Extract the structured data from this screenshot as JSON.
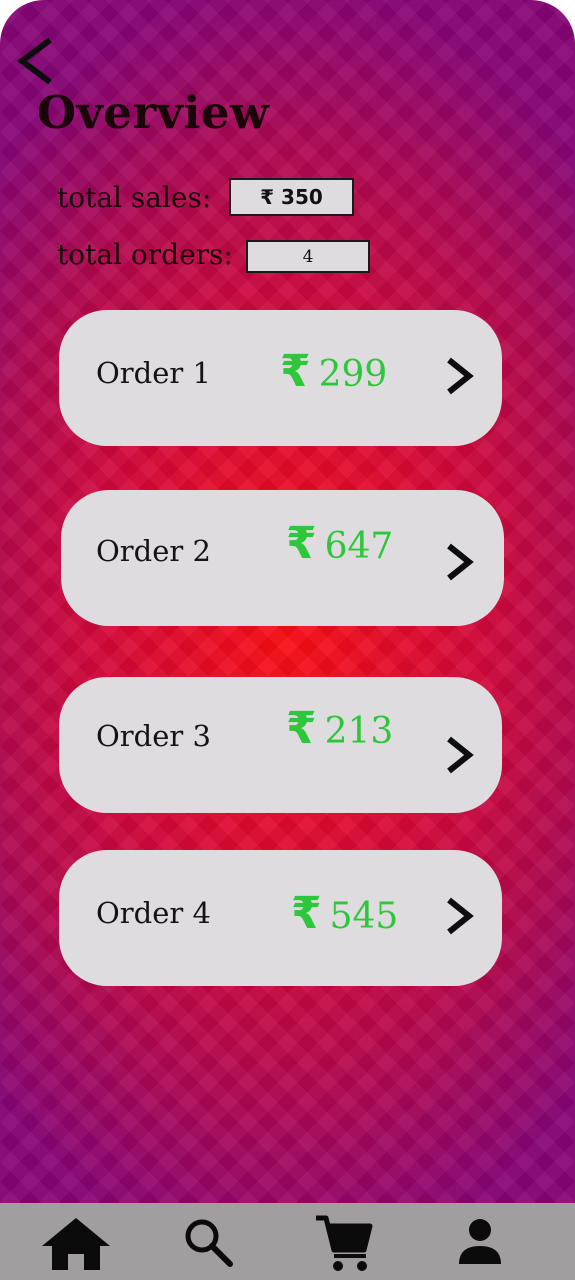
{
  "header": {
    "back_icon": "chevron-left-icon",
    "title": "Overview"
  },
  "stats": {
    "total_sales_label": "total sales:",
    "total_sales_value": "₹ 350",
    "total_orders_label": "total orders:",
    "total_orders_value": "4"
  },
  "orders": [
    {
      "name": "Order 1",
      "currency": "₹",
      "amount": "299"
    },
    {
      "name": "Order 2",
      "currency": "₹",
      "amount": "647"
    },
    {
      "name": "Order 3",
      "currency": "₹",
      "amount": "213"
    },
    {
      "name": "Order 4",
      "currency": "₹",
      "amount": "545"
    }
  ],
  "bottom_nav": {
    "items": [
      "home-icon",
      "search-icon",
      "cart-icon",
      "profile-icon"
    ]
  },
  "colors": {
    "background_center": "#fb0d12",
    "background_edge": "#870575",
    "card": "#dfdcdf",
    "amount": "#2ec63a",
    "nav_bar": "#a09e9f"
  }
}
